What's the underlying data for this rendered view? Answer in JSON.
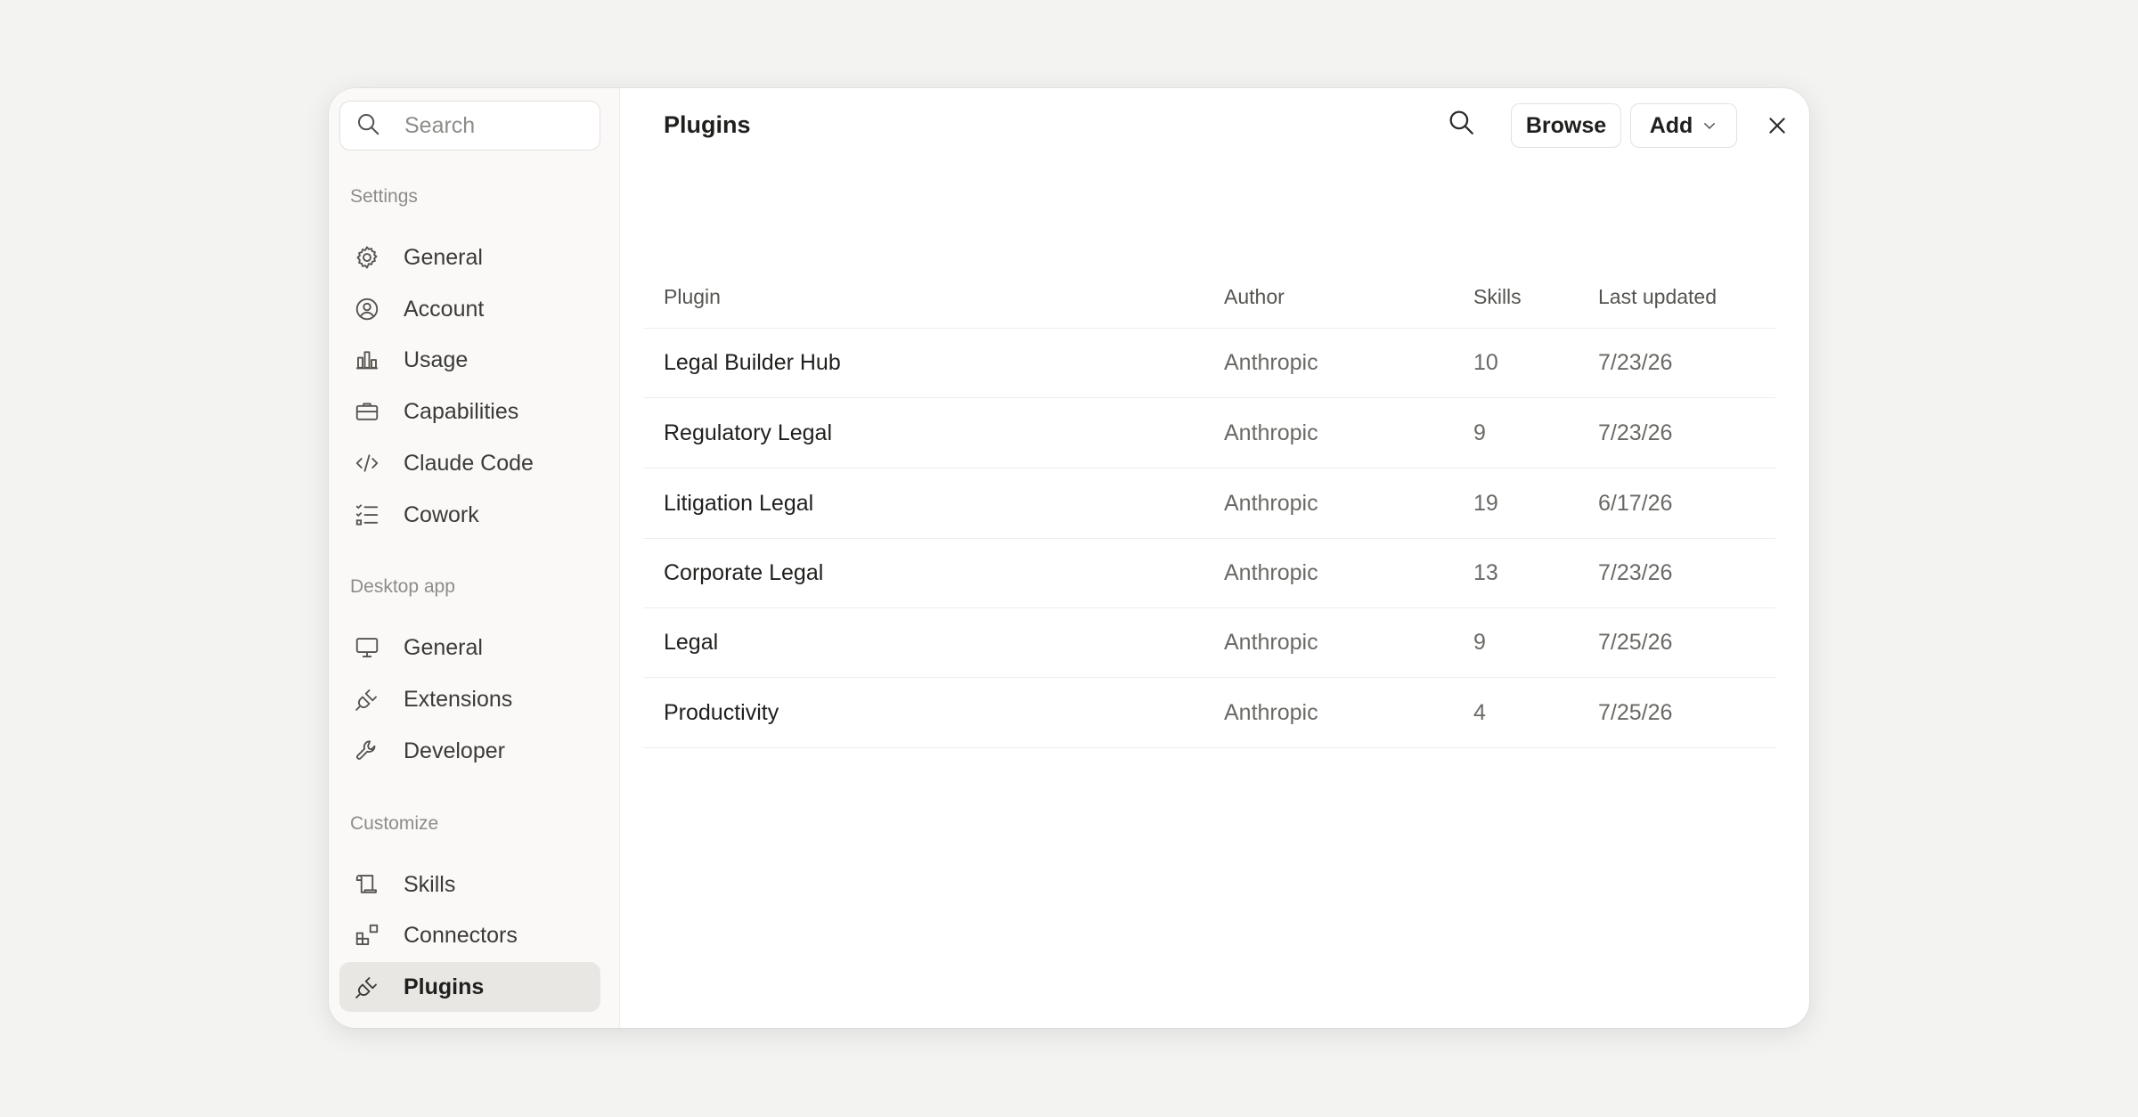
{
  "sidebar": {
    "search_placeholder": "Search",
    "sections": [
      {
        "label": "Settings",
        "items": [
          {
            "label": "General",
            "icon": "gear-icon"
          },
          {
            "label": "Account",
            "icon": "user-circle-icon"
          },
          {
            "label": "Usage",
            "icon": "bar-chart-icon"
          },
          {
            "label": "Capabilities",
            "icon": "briefcase-icon"
          },
          {
            "label": "Claude Code",
            "icon": "code-icon"
          },
          {
            "label": "Cowork",
            "icon": "checklist-icon"
          }
        ]
      },
      {
        "label": "Desktop app",
        "items": [
          {
            "label": "General",
            "icon": "monitor-icon"
          },
          {
            "label": "Extensions",
            "icon": "plug-icon"
          },
          {
            "label": "Developer",
            "icon": "wrench-icon"
          }
        ]
      },
      {
        "label": "Customize",
        "items": [
          {
            "label": "Skills",
            "icon": "scroll-icon"
          },
          {
            "label": "Connectors",
            "icon": "blocks-icon"
          },
          {
            "label": "Plugins",
            "icon": "plug-icon",
            "active": true
          }
        ]
      }
    ]
  },
  "main": {
    "title": "Plugins",
    "browse_label": "Browse",
    "add_label": "Add",
    "table": {
      "columns": [
        "Plugin",
        "Author",
        "Skills",
        "Last updated"
      ],
      "rows": [
        [
          "Legal Builder Hub",
          "Anthropic",
          "10",
          "7/23/26"
        ],
        [
          "Regulatory Legal",
          "Anthropic",
          "9",
          "7/23/26"
        ],
        [
          "Litigation Legal",
          "Anthropic",
          "19",
          "6/17/26"
        ],
        [
          "Corporate Legal",
          "Anthropic",
          "13",
          "7/23/26"
        ],
        [
          "Legal",
          "Anthropic",
          "9",
          "7/25/26"
        ],
        [
          "Productivity",
          "Anthropic",
          "4",
          "7/25/26"
        ]
      ]
    }
  }
}
